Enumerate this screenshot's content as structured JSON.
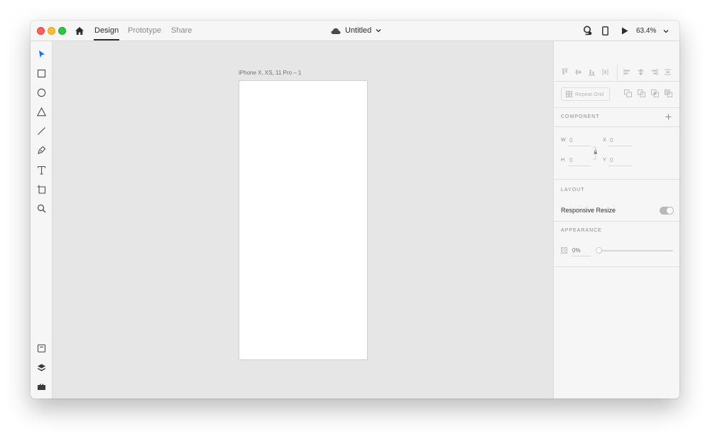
{
  "titlebar": {
    "tabs": [
      {
        "label": "Design",
        "active": true
      },
      {
        "label": "Prototype",
        "active": false
      },
      {
        "label": "Share",
        "active": false
      }
    ],
    "document_title": "Untitled",
    "zoom": "63.4%"
  },
  "toolbar": {
    "tools": [
      "select-icon",
      "rectangle-icon",
      "ellipse-icon",
      "polygon-icon",
      "line-icon",
      "pen-icon",
      "text-icon",
      "artboard-icon",
      "zoom-icon"
    ],
    "bottom_tools": [
      "assets-icon",
      "layers-icon",
      "plugins-icon"
    ]
  },
  "canvas": {
    "artboard_label": "iPhone X, XS, 11 Pro – 1"
  },
  "panel": {
    "repeat_grid_label": "Repeat Grid",
    "component_label": "COMPONENT",
    "fields": {
      "w_label": "W",
      "w_value": "0",
      "h_label": "H",
      "h_value": "0",
      "x_label": "X",
      "x_value": "0",
      "y_label": "Y",
      "y_value": "0"
    },
    "layout_label": "LAYOUT",
    "responsive_resize_label": "Responsive Resize",
    "responsive_resize_on": true,
    "appearance_label": "APPEARANCE",
    "opacity_value": "0%"
  },
  "colors": {
    "accent_select": "#1473e6",
    "canvas_bg": "#e6e6e6",
    "panel_bg": "#f6f6f6"
  }
}
